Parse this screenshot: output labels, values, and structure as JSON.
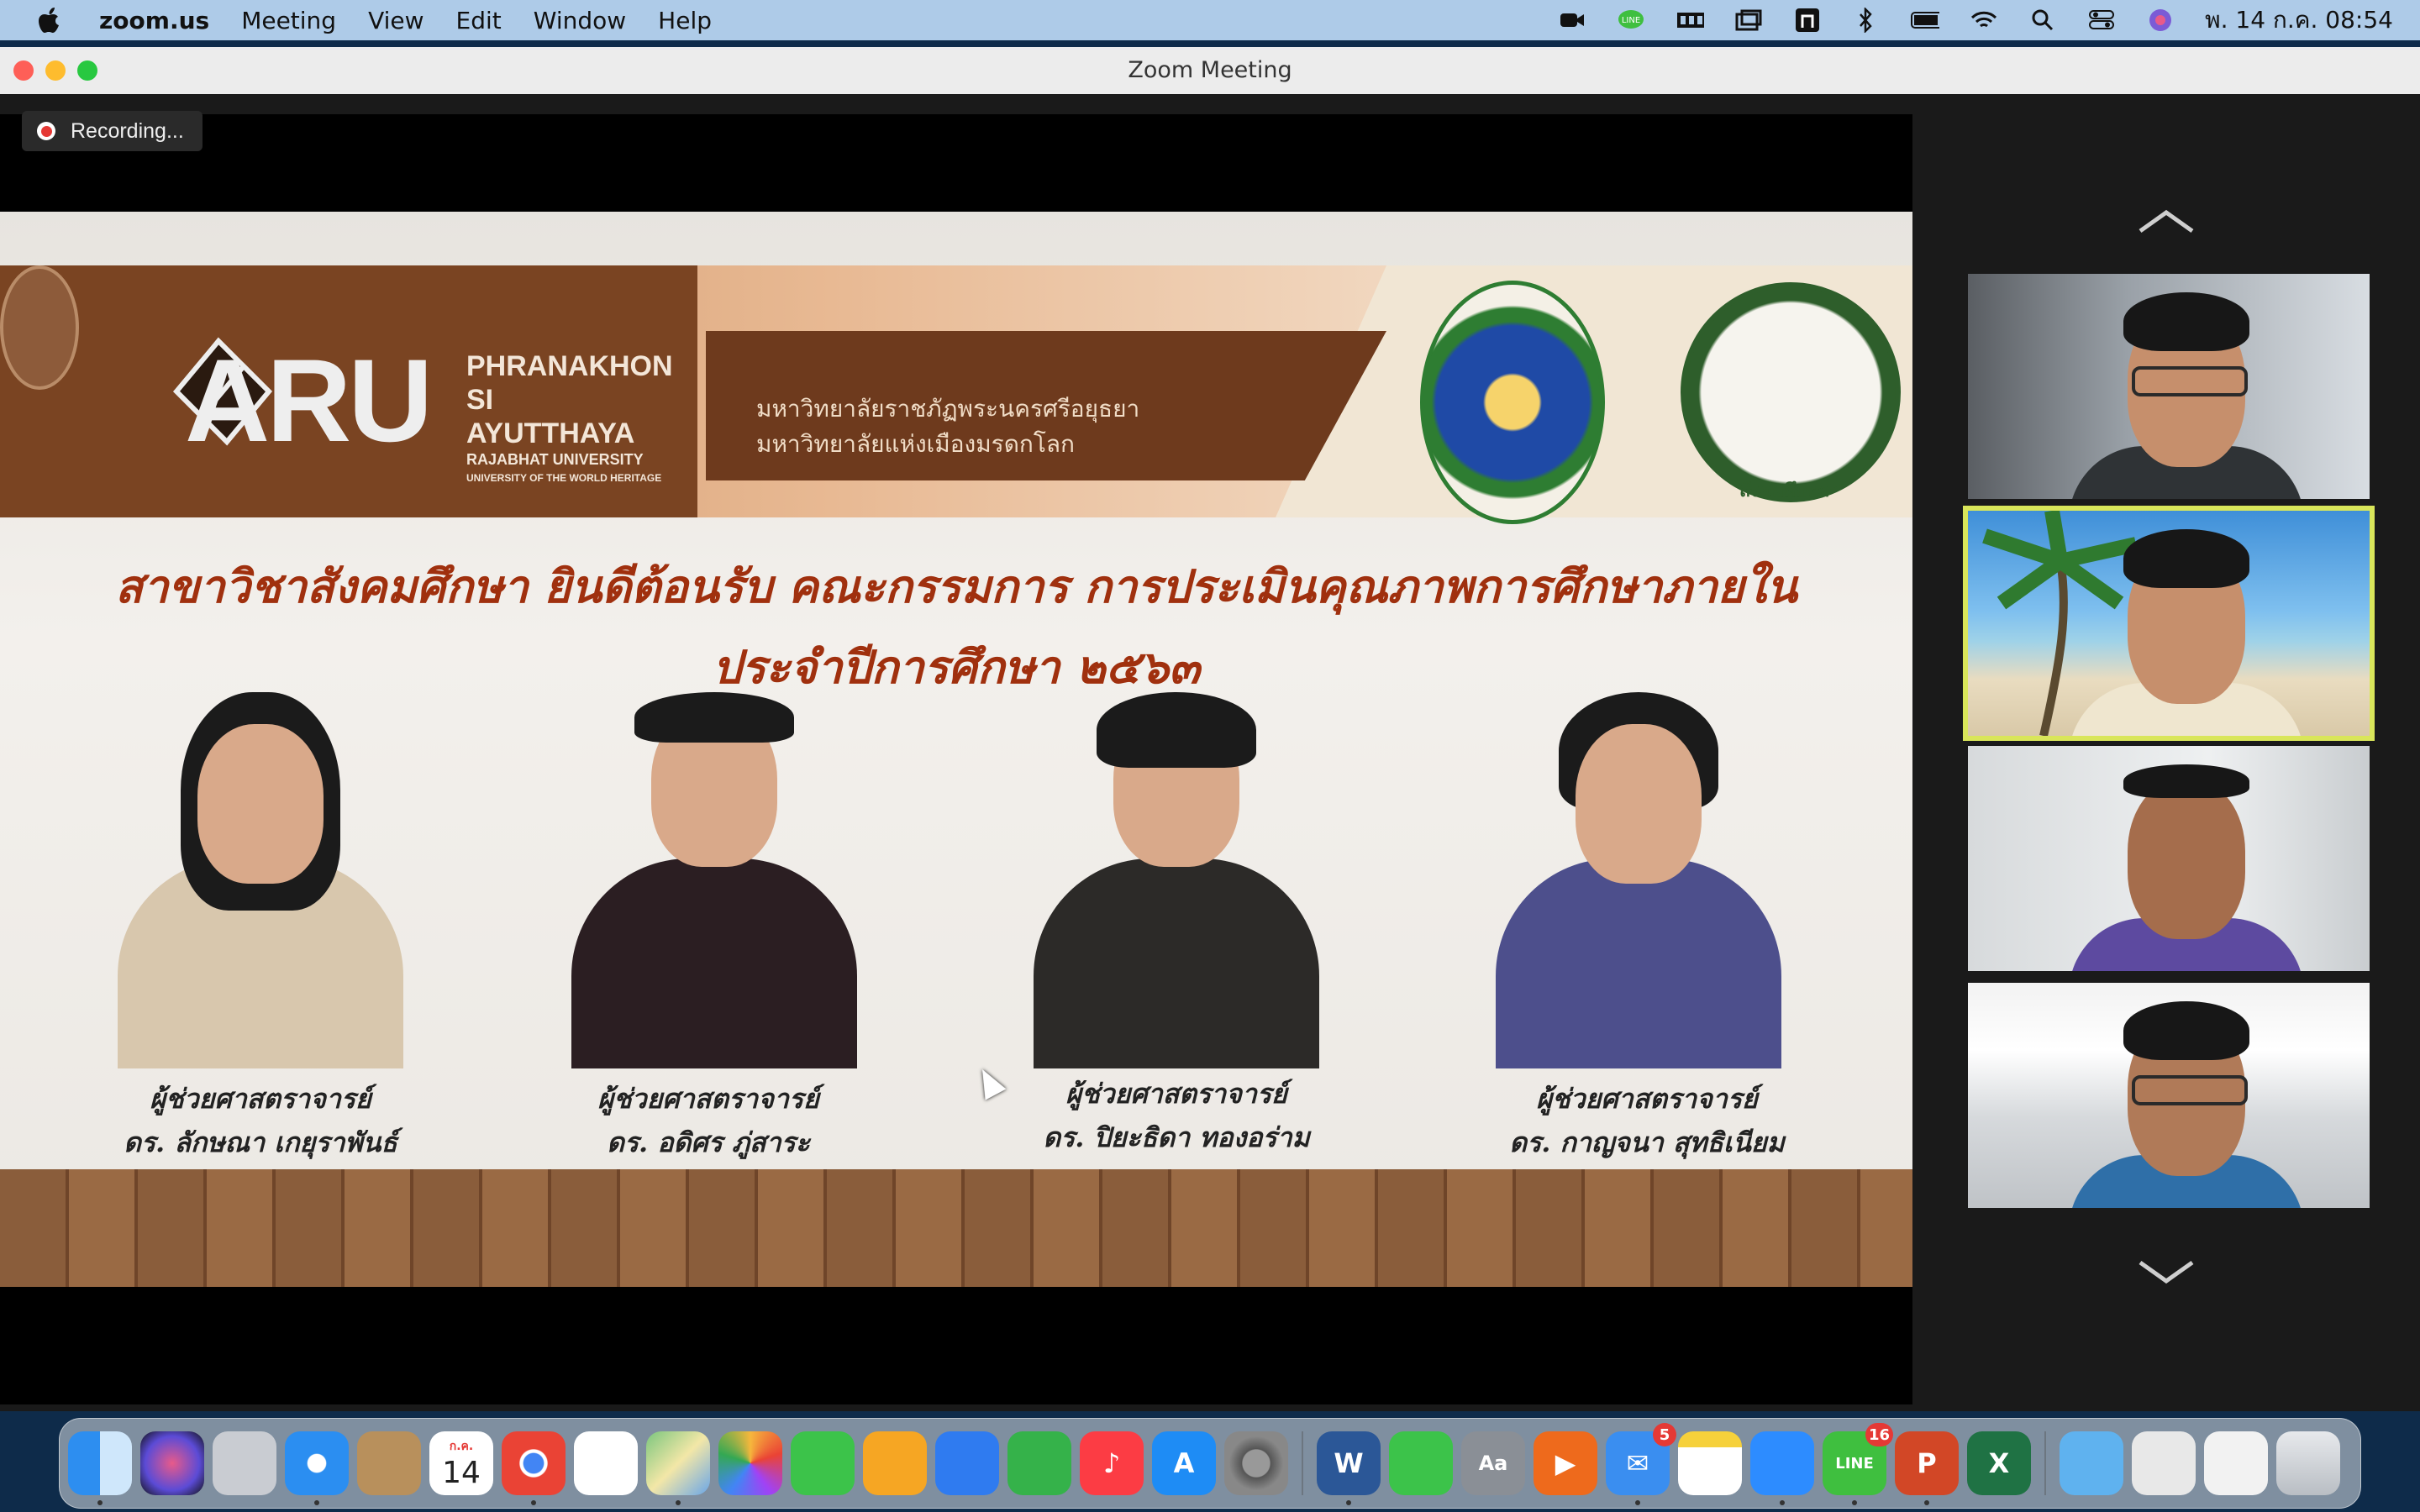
{
  "menubar": {
    "app_name": "zoom.us",
    "menus": [
      "Meeting",
      "View",
      "Edit",
      "Window",
      "Help"
    ],
    "clock": "พ. 14 ก.ค.  08:54"
  },
  "window": {
    "title": "Zoom Meeting"
  },
  "recording": {
    "label": "Recording..."
  },
  "slide": {
    "logo_text": "ARU",
    "logo_name_line1": "PHRANAKHON SI",
    "logo_name_line2": "AYUTTHAYA",
    "logo_name_line3": "RAJABHAT UNIVERSITY",
    "logo_name_line4": "UNIVERSITY OF THE WORLD HERITAGE",
    "thai_line1": "มหาวิทยาลัยราชภัฏพระนครศรีอยุธยา",
    "thai_line2": "มหาวิทยาลัยแห่งเมืองมรดกโลก",
    "emblem_text": "สังคมศึกษา",
    "title_line1": "สาขาวิชาสังคมศึกษา ยินดีต้อนรับ คณะกรรมการ การประเมินคุณภาพการศึกษาภายใน",
    "title_line2": "ประจำปีการศึกษา ๒๕๖๓",
    "people": [
      {
        "title": "ผู้ช่วยศาสตราจารย์",
        "name": "ดร. ลักษณา เกยุราพันธ์"
      },
      {
        "title": "ผู้ช่วยศาสตราจารย์",
        "name": "ดร. อดิศร  ภู่สาระ"
      },
      {
        "title": "ผู้ช่วยศาสตราจารย์",
        "name": "ดร. ปิยะธิดา  ทองอร่าม"
      },
      {
        "title": "ผู้ช่วยศาสตราจารย์",
        "name": "ดร. กาญจนา  สุทธิเนียม"
      }
    ]
  },
  "panel": {
    "up_icon": "chevron-up-icon",
    "down_icon": "chevron-down-icon",
    "active_tile": 2
  },
  "dock": {
    "calendar_month": "ก.ค.",
    "calendar_day": "14",
    "mail_badge": "5",
    "line_badge": "16"
  },
  "colors": {
    "menubar_bg": "#aecbe8",
    "slide_title": "#a0300e",
    "active_speaker": "#d9e65a",
    "aru_brown": "#7a4422"
  }
}
